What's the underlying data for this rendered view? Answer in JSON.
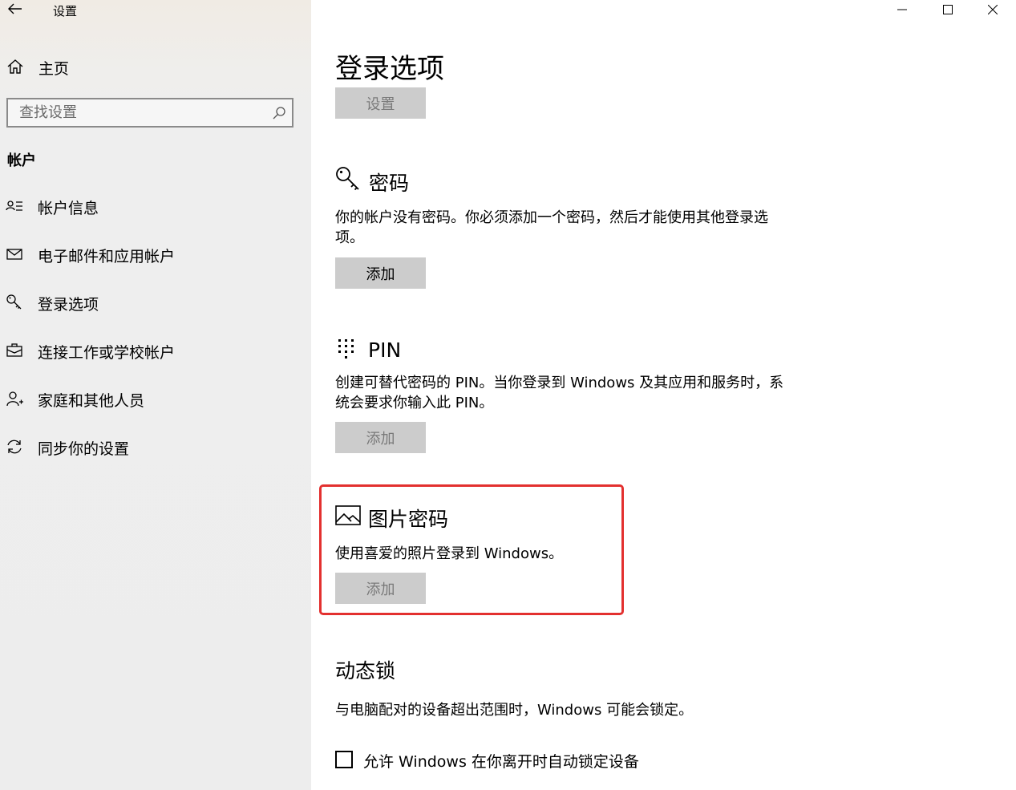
{
  "window": {
    "title": "设置",
    "controls": [
      "minimize",
      "maximize",
      "close"
    ]
  },
  "sidebar": {
    "home_label": "主页",
    "search_placeholder": "查找设置",
    "section_heading": "帐户",
    "items": [
      {
        "label": "帐户信息",
        "icon": "account-info-icon"
      },
      {
        "label": "电子邮件和应用帐户",
        "icon": "mail-icon"
      },
      {
        "label": "登录选项",
        "icon": "key-icon"
      },
      {
        "label": "连接工作或学校帐户",
        "icon": "briefcase-icon"
      },
      {
        "label": "家庭和其他人员",
        "icon": "person-add-icon"
      },
      {
        "label": "同步你的设置",
        "icon": "sync-icon"
      }
    ]
  },
  "main": {
    "title": "登录选项",
    "top_button": "设置",
    "password": {
      "title": "密码",
      "description": "你的帐户没有密码。你必须添加一个密码，然后才能使用其他登录选项。",
      "button": "添加"
    },
    "pin": {
      "title": "PIN",
      "description": "创建可替代密码的 PIN。当你登录到 Windows 及其应用和服务时，系统会要求你输入此 PIN。",
      "button": "添加"
    },
    "picture_password": {
      "title": "图片密码",
      "description": "使用喜爱的照片登录到 Windows。",
      "button": "添加"
    },
    "dynamic_lock": {
      "title": "动态锁",
      "description": "与电脑配对的设备超出范围时，Windows 可能会锁定。",
      "checkbox_label": "允许 Windows 在你离开时自动锁定设备",
      "checked": false
    }
  },
  "colors": {
    "sidebar_bg": "#eeeeee",
    "button_bg": "#cccccc",
    "highlight": "#e3302f"
  }
}
